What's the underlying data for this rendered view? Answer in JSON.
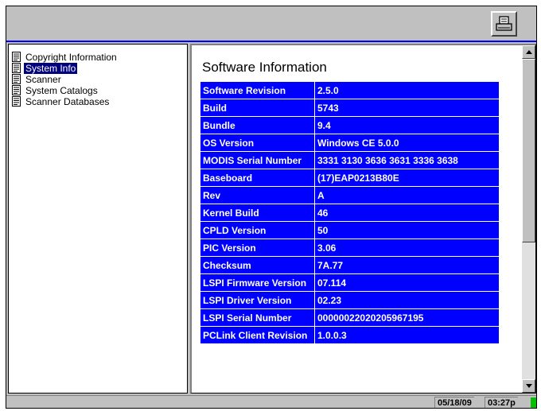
{
  "toolbar": {
    "print_icon": "printer-icon"
  },
  "tree": {
    "items": [
      {
        "label": "Copyright Information",
        "selected": false
      },
      {
        "label": "System Info",
        "selected": true
      },
      {
        "label": "Scanner",
        "selected": false
      },
      {
        "label": "System Catalogs",
        "selected": false
      },
      {
        "label": "Scanner Databases",
        "selected": false
      }
    ]
  },
  "main": {
    "title": "Software Information",
    "rows": [
      {
        "key": "Software Revision",
        "value": "2.5.0"
      },
      {
        "key": "Build",
        "value": "5743"
      },
      {
        "key": "Bundle",
        "value": "9.4"
      },
      {
        "key": "OS Version",
        "value": "Windows CE 5.0.0"
      },
      {
        "key": "MODIS Serial Number",
        "value": "3331 3130 3636 3631 3336 3638"
      },
      {
        "key": "Baseboard",
        "value": "(17)EAP0213B80E"
      },
      {
        "key": "Rev",
        "value": "A"
      },
      {
        "key": "Kernel Build",
        "value": "46"
      },
      {
        "key": "CPLD Version",
        "value": "50"
      },
      {
        "key": "PIC Version",
        "value": "3.06"
      },
      {
        "key": "Checksum",
        "value": "7A.77"
      },
      {
        "key": "LSPI Firmware Version",
        "value": "07.114"
      },
      {
        "key": "LSPI Driver Version",
        "value": "02.23"
      },
      {
        "key": "LSPI Serial Number",
        "value": "00000022020205967195"
      },
      {
        "key": "PCLink Client Revision",
        "value": "1.0.0.3"
      }
    ]
  },
  "status": {
    "date": "05/18/09",
    "time": "03:27p"
  },
  "colors": {
    "table_bg": "#0000ff",
    "selection": "#00007f",
    "chrome": "#c0c0c0",
    "indicator": "#00c000"
  }
}
